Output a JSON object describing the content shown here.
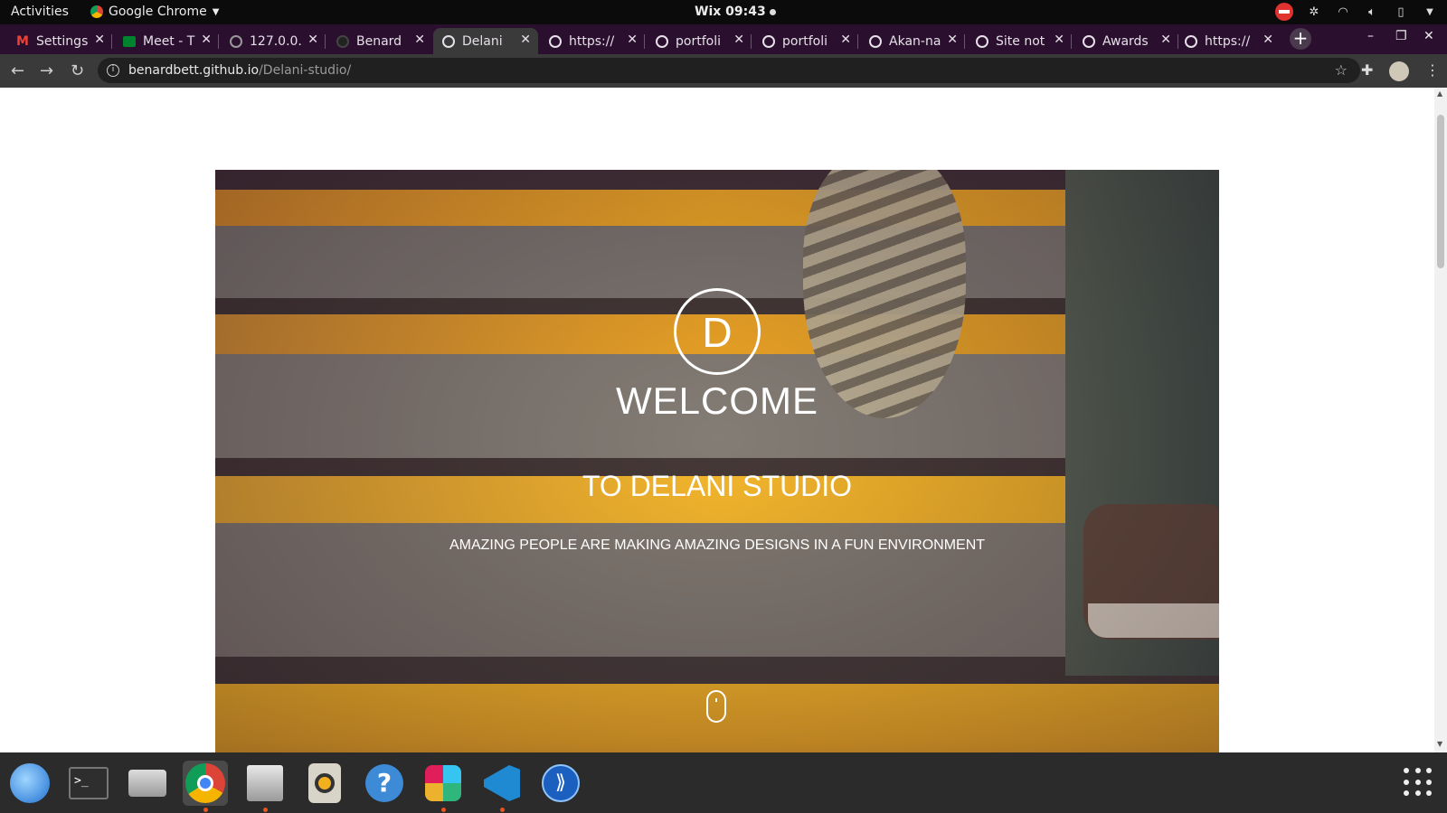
{
  "system": {
    "activities_label": "Activities",
    "app_name": "Google Chrome",
    "clock": "Wix 09:43"
  },
  "browser": {
    "tabs": [
      {
        "label": "Settings",
        "icon": "gmail-icon"
      },
      {
        "label": "Meet - T",
        "icon": "meet-icon"
      },
      {
        "label": "127.0.0.",
        "icon": "globe-icon"
      },
      {
        "label": "Benard",
        "icon": "github-icon"
      },
      {
        "label": "Delani",
        "icon": "globe-icon",
        "active": true
      },
      {
        "label": "https://",
        "icon": "globe-icon"
      },
      {
        "label": "portfoli",
        "icon": "globe-icon"
      },
      {
        "label": "portfoli",
        "icon": "globe-icon"
      },
      {
        "label": "Akan-na",
        "icon": "globe-icon"
      },
      {
        "label": "Site not",
        "icon": "globe-icon"
      },
      {
        "label": "Awards",
        "icon": "globe-icon"
      },
      {
        "label": "https://",
        "icon": "globe-icon"
      }
    ],
    "url_host": "benardbett.github.io",
    "url_path": "/Delani-studio/"
  },
  "hero": {
    "logo_letter": "D",
    "welcome": "WELCOME",
    "subtitle": "TO DELANI STUDIO",
    "tagline": "AMAZING PEOPLE ARE MAKING AMAZING DESIGNS IN A FUN ENVIRONMENT"
  },
  "dock": {
    "items": [
      "thunderbird-icon",
      "terminal-icon",
      "scanner-icon",
      "chrome-icon",
      "files-icon",
      "rhythmbox-icon",
      "help-icon",
      "slack-icon",
      "vscode-icon",
      "zoom-icon"
    ]
  },
  "colors": {
    "tab_strip": "#2a0f2e",
    "toolbar": "#3a3a3a",
    "stair_yellow": "#f2a81c",
    "dock": "#2b2b2b",
    "accent": "#e95420"
  }
}
